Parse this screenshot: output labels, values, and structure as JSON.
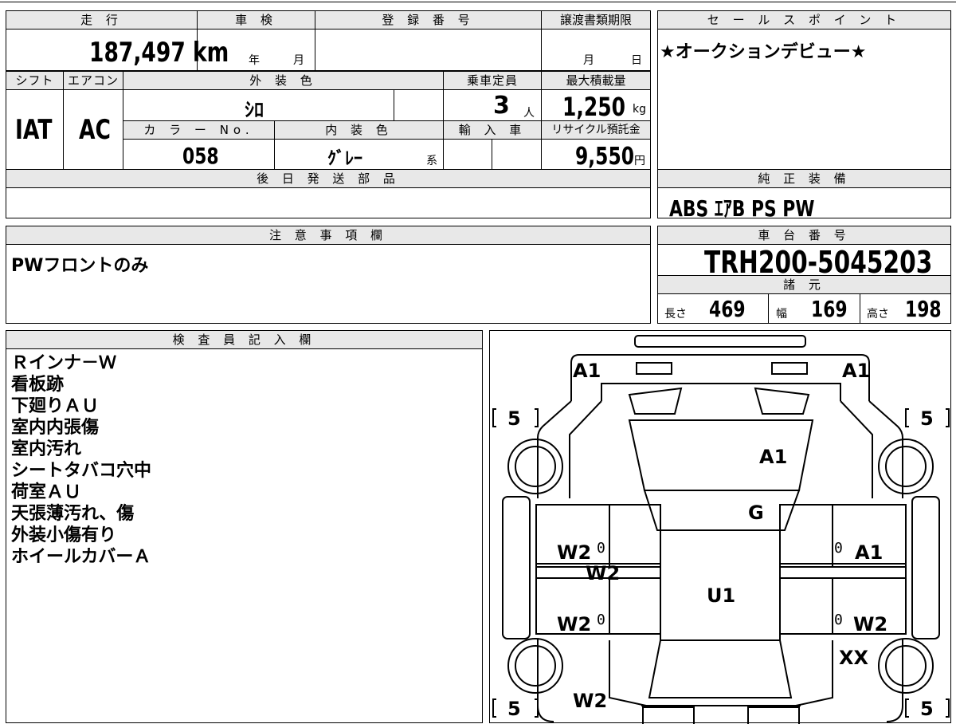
{
  "mileage": {
    "header": "走 行",
    "value": "187,497 km"
  },
  "inspection": {
    "header": "車 検",
    "year_unit": "年",
    "month_unit": "月"
  },
  "registration": {
    "header": "登 録 番 号"
  },
  "transfer_deadline": {
    "header": "譲渡書類期限",
    "month_unit": "月",
    "day_unit": "日"
  },
  "sales_point": {
    "header": "セ ー ル ス ポ イ ン ト",
    "text": "★オークションデビュー★"
  },
  "shift": {
    "header": "シフト",
    "value": "IAT"
  },
  "aircon": {
    "header": "エアコン",
    "value": "AC"
  },
  "exterior_color": {
    "header": "外 装 色",
    "value": "ｼﾛ"
  },
  "capacity": {
    "header": "乗車定員",
    "value": "3",
    "unit": "人"
  },
  "max_load": {
    "header": "最大積載量",
    "value": "1,250",
    "unit": "kg"
  },
  "color_no": {
    "header": "カ ラ ー No.",
    "value": "058"
  },
  "interior_color": {
    "header": "内 装 色",
    "value": "ｸﾞﾚｰ",
    "suffix": "系"
  },
  "import": {
    "header": "輸 入 車"
  },
  "recycle": {
    "header": "リサイクル預託金",
    "value": "9,550",
    "unit": "円"
  },
  "later_parts": {
    "header": "後 日 発 送 部 品"
  },
  "genuine_equipment": {
    "header": "純 正 装 備",
    "value": "ABS ｴｱB PS PW"
  },
  "caution": {
    "header": "注 意 事 項 欄",
    "text": "PWフロントのみ"
  },
  "chassis": {
    "header": "車 台 番 号",
    "value": "TRH200-5045203"
  },
  "specs": {
    "header": "諸 元",
    "length_label": "長さ",
    "length": "469",
    "width_label": "幅",
    "width": "169",
    "height_label": "高さ",
    "height": "198"
  },
  "inspector": {
    "header": "検 査 員 記 入 欄",
    "notes": [
      "Ｒインナ－Ｗ",
      "看板跡",
      "下廻りＡＵ",
      "室内内張傷",
      "室内汚れ",
      "シートタバコ穴中",
      "荷室ＡＵ",
      "天張薄汚れ、傷",
      "外装小傷有り",
      "ホイールカバーＡ"
    ]
  },
  "diagram": {
    "front_left": "A1",
    "front_right": "A1",
    "tire_fl": "5",
    "tire_fr": "5",
    "tire_rl": "5",
    "tire_rr": "5",
    "hood": "A1",
    "windshield": "G",
    "door_fl": "W2",
    "door_fr": "A1",
    "door_rl": "W2",
    "door_rr": "W2",
    "pillar_l": "W2",
    "roof": "U1",
    "rear_right": "XX",
    "rear_left": "W2",
    "zero": "0"
  }
}
